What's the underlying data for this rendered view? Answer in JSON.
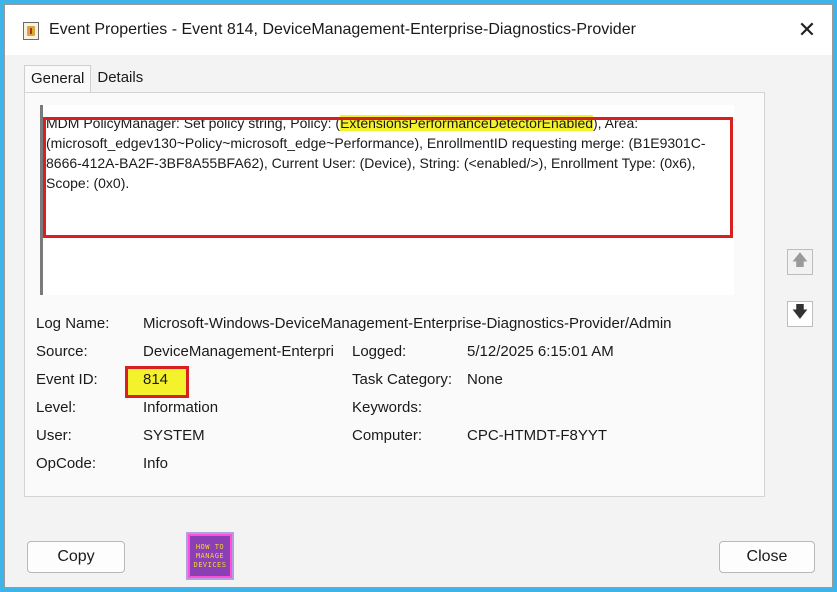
{
  "window": {
    "title": "Event Properties - Event 814, DeviceManagement-Enterprise-Diagnostics-Provider",
    "close_glyph": "✕"
  },
  "tabs": [
    {
      "label": "General",
      "active": true
    },
    {
      "label": "Details",
      "active": false
    }
  ],
  "description": {
    "prefix": "MDM PolicyManager: Set policy string, Policy: (",
    "highlighted": "ExtensionsPerformanceDetectorEnabled",
    "suffix": "), Area: (microsoft_edgev130~Policy~microsoft_edge~Performance), EnrollmentID requesting merge: (B1E9301C-8666-412A-BA2F-3BF8A55BFA62), Current User: (Device), String: (<enabled/>), Enrollment Type: (0x6), Scope: (0x0)."
  },
  "fields": {
    "log_name": {
      "label": "Log Name:",
      "value": "Microsoft-Windows-DeviceManagement-Enterprise-Diagnostics-Provider/Admin"
    },
    "source": {
      "label": "Source:",
      "value": "DeviceManagement-Enterpri"
    },
    "logged": {
      "label": "Logged:",
      "value": "5/12/2025 6:15:01 AM"
    },
    "event_id": {
      "label": "Event ID:",
      "value": "814"
    },
    "task_category": {
      "label": "Task Category:",
      "value": "None"
    },
    "level": {
      "label": "Level:",
      "value": "Information"
    },
    "keywords": {
      "label": "Keywords:",
      "value": ""
    },
    "user": {
      "label": "User:",
      "value": "SYSTEM"
    },
    "computer": {
      "label": "Computer:",
      "value": "CPC-HTMDT-F8YYT"
    },
    "opcode": {
      "label": "OpCode:",
      "value": "Info"
    }
  },
  "buttons": {
    "copy": "Copy",
    "close": "Close"
  },
  "scroll": {
    "up_glyph": "🡅",
    "down_glyph": "🡇"
  },
  "logo": {
    "lines": [
      "HOW TO",
      "MANAGE",
      "DEVICES"
    ]
  },
  "colors": {
    "background": "#3fb4e8",
    "highlight": "#f4f22a",
    "annotation_red": "#d82020"
  }
}
